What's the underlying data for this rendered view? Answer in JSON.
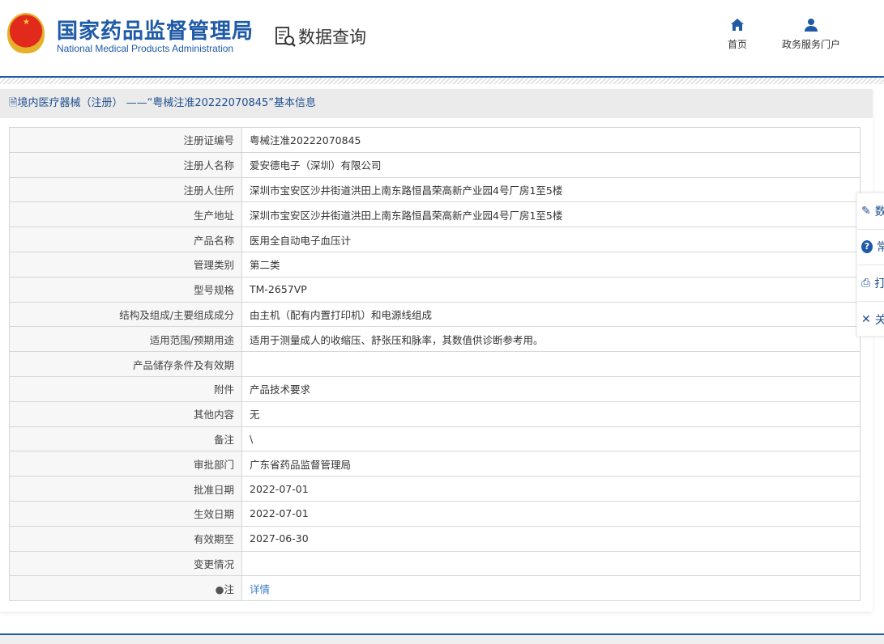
{
  "header": {
    "brand_cn": "国家药品监督管理局",
    "brand_en": "National Medical Products Administration",
    "section": "数据查询",
    "nav": [
      {
        "label": "首页",
        "icon": "home-icon"
      },
      {
        "label": "政务服务门户",
        "icon": "user-icon"
      }
    ]
  },
  "panel": {
    "title": "境内医疗器械（注册） ——“粤械注准20222070845”基本信息"
  },
  "rows": [
    {
      "label": "注册证编号",
      "value": "粤械注准20222070845"
    },
    {
      "label": "注册人名称",
      "value": "爱安德电子（深圳）有限公司"
    },
    {
      "label": "注册人住所",
      "value": "深圳市宝安区沙井街道洪田上南东路恒昌荣高新产业园4号厂房1至5楼"
    },
    {
      "label": "生产地址",
      "value": "深圳市宝安区沙井街道洪田上南东路恒昌荣高新产业园4号厂房1至5楼"
    },
    {
      "label": "产品名称",
      "value": "医用全自动电子血压计"
    },
    {
      "label": "管理类别",
      "value": "第二类"
    },
    {
      "label": "型号规格",
      "value": "TM-2657VP"
    },
    {
      "label": "结构及组成/主要组成成分",
      "value": "由主机（配有内置打印机）和电源线组成"
    },
    {
      "label": "适用范围/预期用途",
      "value": "适用于测量成人的收缩压、舒张压和脉率，其数值供诊断参考用。"
    },
    {
      "label": "产品储存条件及有效期",
      "value": ""
    },
    {
      "label": "附件",
      "value": "产品技术要求"
    },
    {
      "label": "其他内容",
      "value": "无"
    },
    {
      "label": "备注",
      "value": "\\"
    },
    {
      "label": "审批部门",
      "value": "广东省药品监督管理局"
    },
    {
      "label": "批准日期",
      "value": "2022-07-01"
    },
    {
      "label": "生效日期",
      "value": "2022-07-01"
    },
    {
      "label": "有效期至",
      "value": "2027-06-30"
    },
    {
      "label": "变更情况",
      "value": ""
    }
  ],
  "note": {
    "label": "注",
    "link": "详情"
  },
  "side": [
    {
      "icon": "edit-icon",
      "label": "数"
    },
    {
      "icon": "help-icon",
      "label": "常"
    },
    {
      "icon": "print-icon",
      "label": "打"
    },
    {
      "icon": "close-icon",
      "label": "关"
    }
  ]
}
